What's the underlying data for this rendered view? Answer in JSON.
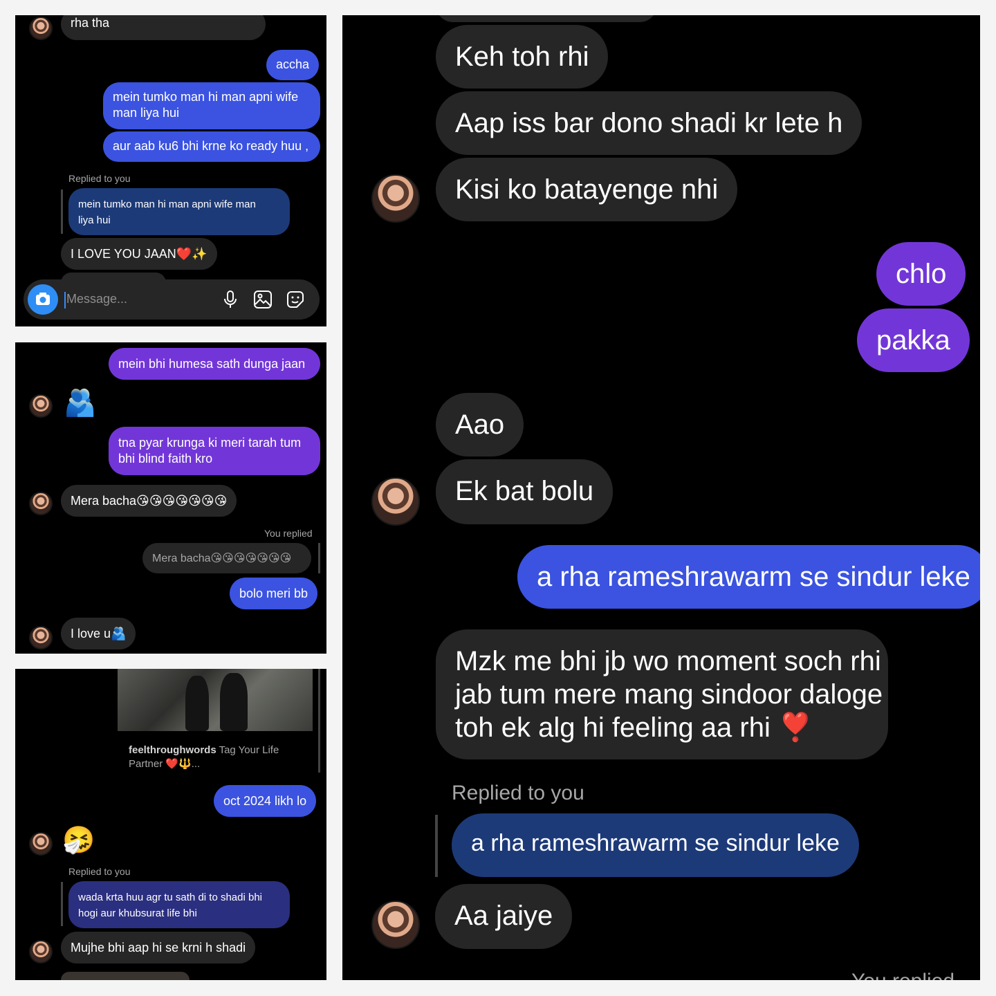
{
  "panel1": {
    "m0": "rha tha",
    "m1": "accha",
    "m2a": "mein tumko man hi man apni wife",
    "m2b": "man liya hui",
    "m3": "aur aab ku6 bhi krne ko ready huu ,",
    "reply_label": "Replied to you",
    "quote_a": "mein tumko man hi man apni wife man",
    "quote_b": "liya hui",
    "m4": "I LOVE YOU JAAN❤️✨",
    "composer_placeholder": "Message..."
  },
  "panel2": {
    "m1": "mein bhi humesa sath dunga jaan",
    "m2": "🫂",
    "m3a": "tna pyar krunga ki meri tarah tum",
    "m3b": "bhi blind faith kro",
    "m4": "Mera bacha😘😘😘😘😘😘😘",
    "reply_label": "You replied",
    "quote": "Mera bacha😘😘😘😘😘😘😘",
    "m5": "bolo meri bb",
    "m6": "I love u🫂"
  },
  "panel3": {
    "post_user": "feelthroughwords",
    "post_caption_a": "Tag Your Life",
    "post_caption_b": "Partner ❤️🔱...",
    "m1": "oct 2024 likh lo",
    "m2": "🤧",
    "reply_label": "Replied to you",
    "quote_a": "wada krta huu agr tu sath di to shadi bhi",
    "quote_b": "hogi aur khubsurat life bhi",
    "m3": "Mujhe bhi aap hi se krni h shadi"
  },
  "panel4": {
    "m1": "Keh toh rhi",
    "m2": "Aap iss bar dono shadi kr lete h",
    "m3": "Kisi ko batayenge nhi",
    "m4": "chlo",
    "m5": "pakka",
    "m6": "Aao",
    "m7": "Ek bat bolu",
    "m8": "a rha rameshrawarm se sindur leke",
    "m9a": "Mzk me bhi jb wo moment soch rhi",
    "m9b": "jab tum mere mang sindoor daloge",
    "m9c": "toh ek alg hi feeling aa rhi ❣️",
    "reply_label": "Replied to you",
    "quote": "a rha rameshrawarm se sindur leke",
    "m10": "Aa jaiye",
    "bottom_label": "You replied"
  }
}
